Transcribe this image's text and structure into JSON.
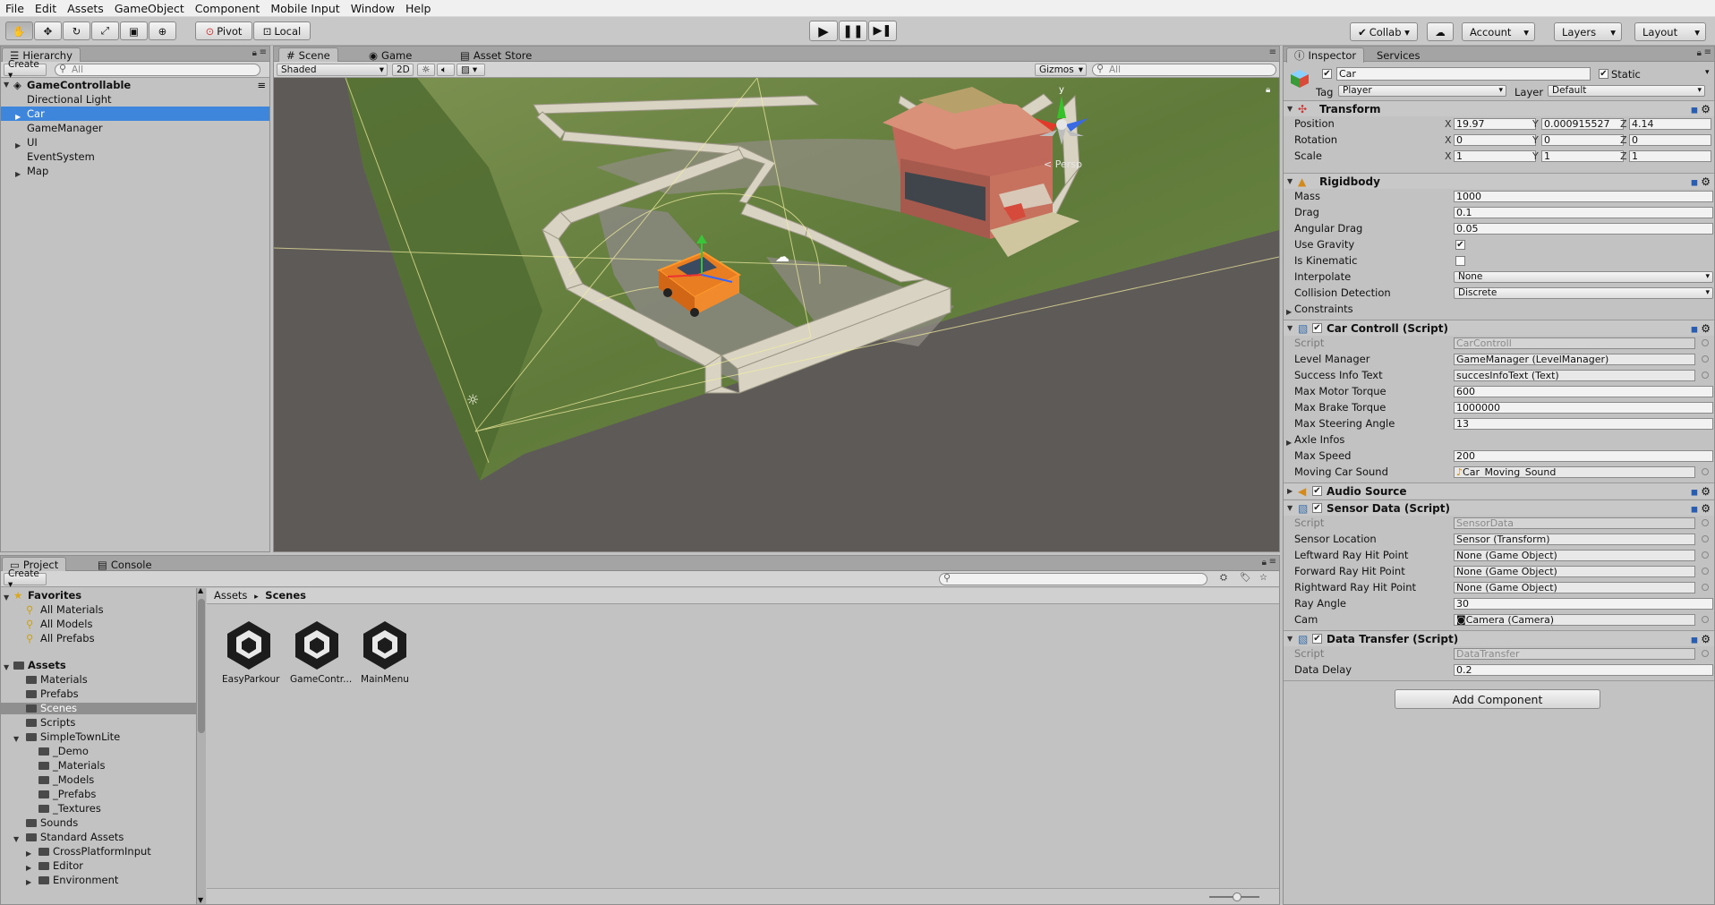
{
  "menu": [
    "File",
    "Edit",
    "Assets",
    "GameObject",
    "Component",
    "Mobile Input",
    "Window",
    "Help"
  ],
  "toolbar": {
    "pivot": "Pivot",
    "local": "Local",
    "collab": "Collab ▾",
    "account": "Account",
    "layers": "Layers",
    "layout": "Layout"
  },
  "hierarchy": {
    "tab": "Hierarchy",
    "create": "Create ▾",
    "search_placeholder": "All",
    "scene_name": "GameControllable",
    "items": [
      {
        "label": "Directional Light",
        "expandable": false,
        "selected": false
      },
      {
        "label": "Car",
        "expandable": true,
        "selected": true
      },
      {
        "label": "GameManager",
        "expandable": false,
        "selected": false
      },
      {
        "label": "UI",
        "expandable": true,
        "selected": false
      },
      {
        "label": "EventSystem",
        "expandable": false,
        "selected": false
      },
      {
        "label": "Map",
        "expandable": true,
        "selected": false
      }
    ]
  },
  "scene": {
    "tabs": [
      "Scene",
      "Game",
      "Asset Store"
    ],
    "shading": "Shaded",
    "mode2d": "2D",
    "gizmos": "Gizmos",
    "search_placeholder": "All",
    "persp": "Persp",
    "axis_y": "y"
  },
  "inspector": {
    "tabs": [
      "Inspector",
      "Services"
    ],
    "object_name": "Car",
    "static_label": "Static",
    "tag_label": "Tag",
    "tag_value": "Player",
    "layer_label": "Layer",
    "layer_value": "Default",
    "transform": {
      "title": "Transform",
      "rows": [
        {
          "label": "Position",
          "x": "19.97",
          "y": "0.000915527",
          "z": "4.14"
        },
        {
          "label": "Rotation",
          "x": "0",
          "y": "0",
          "z": "0"
        },
        {
          "label": "Scale",
          "x": "1",
          "y": "1",
          "z": "1"
        }
      ]
    },
    "rigidbody": {
      "title": "Rigidbody",
      "mass_label": "Mass",
      "mass": "1000",
      "drag_label": "Drag",
      "drag": "0.1",
      "angular_label": "Angular Drag",
      "angular": "0.05",
      "gravity_label": "Use Gravity",
      "gravity": true,
      "kinematic_label": "Is Kinematic",
      "kinematic": false,
      "interpolate_label": "Interpolate",
      "interpolate": "None",
      "collision_label": "Collision Detection",
      "collision": "Discrete",
      "constraints_label": "Constraints"
    },
    "car_controll": {
      "title": "Car Controll (Script)",
      "script_label": "Script",
      "script": "CarControll",
      "level_label": "Level Manager",
      "level": "GameManager (LevelManager)",
      "success_label": "Success Info Text",
      "success": "succesInfoText (Text)",
      "motor_label": "Max Motor Torque",
      "motor": "600",
      "brake_label": "Max Brake Torque",
      "brake": "1000000",
      "steer_label": "Max Steering Angle",
      "steer": "13",
      "axle_label": "Axle Infos",
      "speed_label": "Max Speed",
      "speed": "200",
      "sound_label": "Moving Car Sound",
      "sound": "Car_Moving_Sound"
    },
    "audio_source": {
      "title": "Audio Source"
    },
    "sensor_data": {
      "title": "Sensor Data (Script)",
      "script_label": "Script",
      "script": "SensorData",
      "location_label": "Sensor Location",
      "location": "Sensor (Transform)",
      "leftward_label": "Leftward Ray Hit Point",
      "leftward": "None (Game Object)",
      "forward_label": "Forward Ray Hit Point",
      "forward": "None (Game Object)",
      "rightward_label": "Rightward Ray Hit Point",
      "rightward": "None (Game Object)",
      "angle_label": "Ray Angle",
      "angle": "30",
      "cam_label": "Cam",
      "cam": "Camera (Camera)"
    },
    "data_transfer": {
      "title": "Data Transfer (Script)",
      "script_label": "Script",
      "script": "DataTransfer",
      "delay_label": "Data Delay",
      "delay": "0.2"
    },
    "add_component": "Add Component"
  },
  "project": {
    "tabs": [
      "Project",
      "Console"
    ],
    "create": "Create ▾",
    "favorites": "Favorites",
    "fav_items": [
      "All Materials",
      "All Models",
      "All Prefabs"
    ],
    "assets_root": "Assets",
    "tree": [
      {
        "label": "Materials",
        "indent": 1,
        "expandable": false,
        "selected": false
      },
      {
        "label": "Prefabs",
        "indent": 1,
        "expandable": false,
        "selected": false
      },
      {
        "label": "Scenes",
        "indent": 1,
        "expandable": false,
        "selected": true
      },
      {
        "label": "Scripts",
        "indent": 1,
        "expandable": false,
        "selected": false
      },
      {
        "label": "SimpleTownLite",
        "indent": 1,
        "expandable": true,
        "open": true,
        "selected": false
      },
      {
        "label": "_Demo",
        "indent": 2,
        "expandable": false,
        "selected": false
      },
      {
        "label": "_Materials",
        "indent": 2,
        "expandable": false,
        "selected": false
      },
      {
        "label": "_Models",
        "indent": 2,
        "expandable": false,
        "selected": false
      },
      {
        "label": "_Prefabs",
        "indent": 2,
        "expandable": false,
        "selected": false
      },
      {
        "label": "_Textures",
        "indent": 2,
        "expandable": false,
        "selected": false
      },
      {
        "label": "Sounds",
        "indent": 1,
        "expandable": false,
        "selected": false
      },
      {
        "label": "Standard Assets",
        "indent": 1,
        "expandable": true,
        "open": true,
        "selected": false
      },
      {
        "label": "CrossPlatformInput",
        "indent": 2,
        "expandable": true,
        "selected": false
      },
      {
        "label": "Editor",
        "indent": 2,
        "expandable": true,
        "selected": false
      },
      {
        "label": "Environment",
        "indent": 2,
        "expandable": true,
        "selected": false
      }
    ],
    "breadcrumb_root": "Assets",
    "breadcrumb_sep": "▸",
    "breadcrumb_current": "Scenes",
    "assets": [
      "EasyParkour",
      "GameContr...",
      "MainMenu"
    ]
  }
}
